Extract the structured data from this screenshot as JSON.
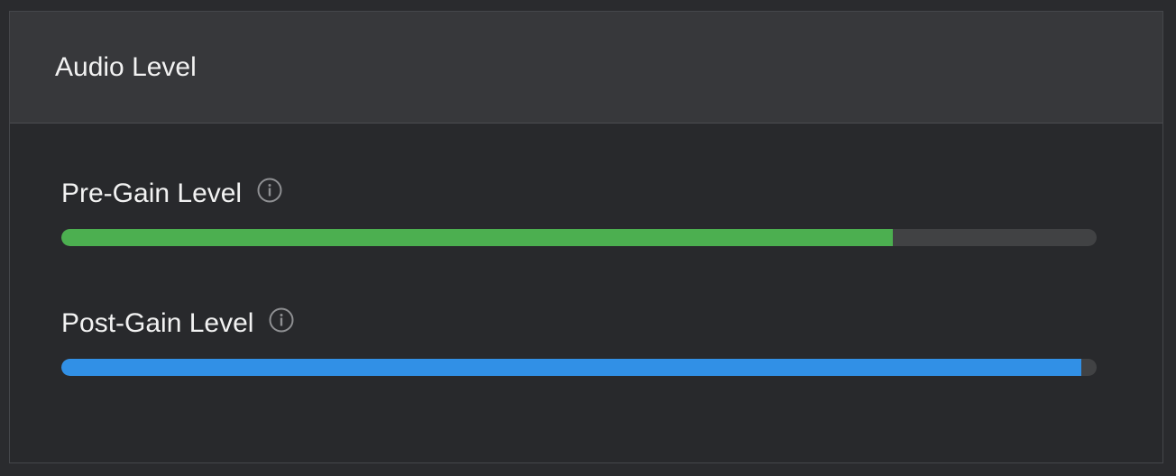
{
  "panel": {
    "title": "Audio Level"
  },
  "meters": [
    {
      "label": "Pre-Gain Level",
      "level": 0.803,
      "color": "#4caf50",
      "icon": "info-icon"
    },
    {
      "label": "Post-Gain Level",
      "level": 0.985,
      "color": "#3190e6",
      "icon": "info-icon"
    }
  ],
  "colors": {
    "background": "#2a2b2e",
    "header": "#37383b",
    "track": "#414244",
    "text": "#f2f2f2"
  }
}
